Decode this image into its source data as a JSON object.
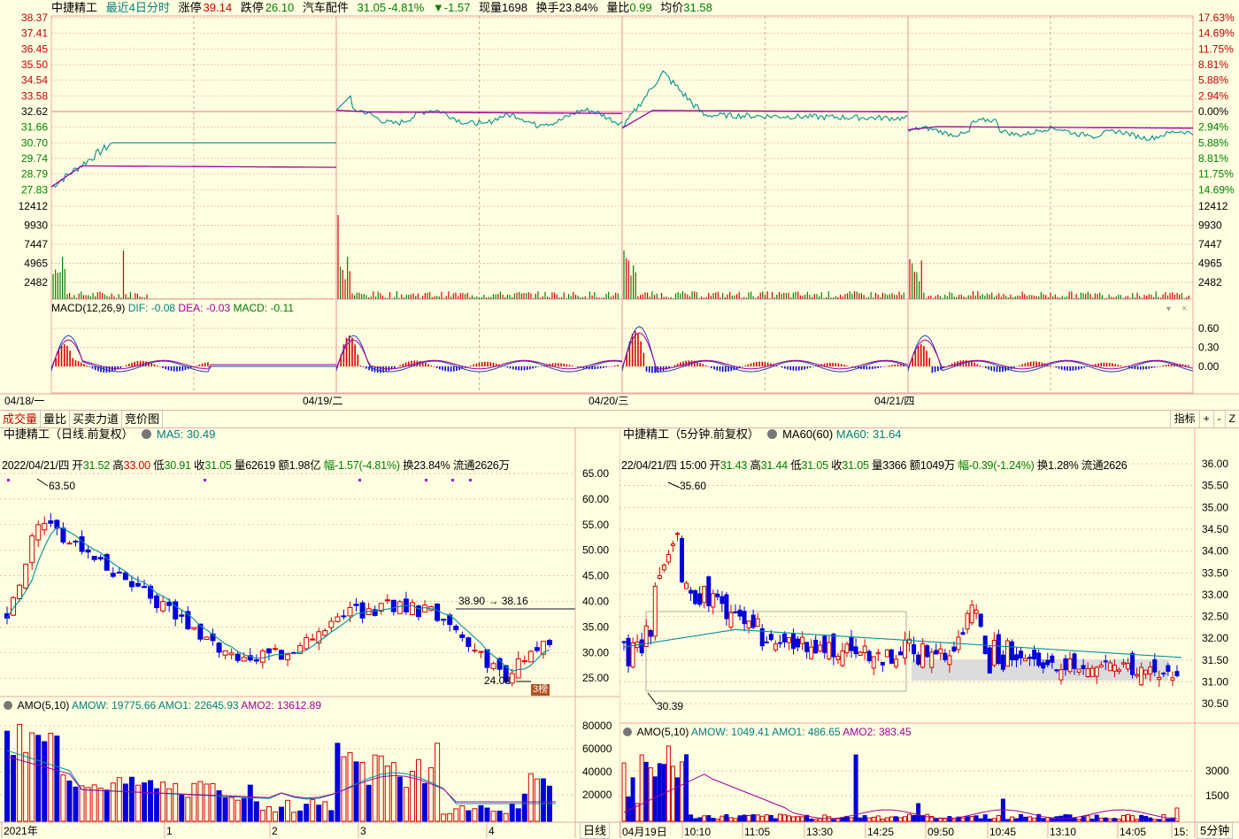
{
  "top": {
    "stock_name": "中捷精工",
    "period_label": "最近4日分时",
    "limit_up_label": "涨停",
    "limit_up_value": "39.14",
    "limit_down_label": "跌停",
    "limit_down_value": "26.10",
    "sector": "汽车配件",
    "price": "31.05",
    "change_pct": "-4.81%",
    "change_arrow": "▼",
    "change_val": "-1.57",
    "volume_label": "现量",
    "volume_value": "1698",
    "turnover_label": "换手",
    "turnover_value": "23.84%",
    "vol_ratio_label": "量比",
    "vol_ratio_value": "0.99",
    "avg_label": "均价",
    "avg_value": "31.58",
    "price_axis_left": [
      "38.37",
      "37.41",
      "36.45",
      "35.50",
      "34.54",
      "33.58",
      "32.62",
      "31.66",
      "30.70",
      "29.74",
      "28.79",
      "27.83"
    ],
    "pct_axis_right": [
      "17.63%",
      "14.69%",
      "11.75%",
      "8.81%",
      "5.88%",
      "2.94%",
      "0.00%",
      "2.94%",
      "5.88%",
      "8.81%",
      "11.75%",
      "14.69%"
    ],
    "vol_axis": [
      "12412",
      "9930",
      "7447",
      "4965",
      "2482"
    ],
    "macd_label": "MACD(12,26,9)",
    "macd_dif": "DIF: -0.08",
    "macd_dea": "DEA: -0.03",
    "macd_val": "MACD: -0.11",
    "macd_axis": [
      "0.60",
      "0.30",
      "0.00"
    ],
    "dates": [
      "04/18/一",
      "04/19/二",
      "04/20/三",
      "04/21/四"
    ]
  },
  "tabs": {
    "items": [
      "成交量",
      "量比",
      "买卖力道",
      "竞价图"
    ],
    "indicator": "指标",
    "plus": "+",
    "minus": "-",
    "z": "Z"
  },
  "daily": {
    "title": "中捷精工（日线.前复权）",
    "ma_label": "MA5: 30.49",
    "info_date": "2022/04/21/四",
    "info_open_label": "开",
    "info_open": "31.52",
    "info_high_label": "高",
    "info_high": "33.00",
    "info_low_label": "低",
    "info_low": "30.91",
    "info_close_label": "收",
    "info_close": "31.05",
    "info_vol": "量62619",
    "info_amt": "额1.98亿",
    "info_range": "幅-1.57(-4.81%)",
    "info_turn": "换23.84%",
    "info_float": "流通2626万",
    "high_mark": "63.50",
    "low_mark": "24.08",
    "range_mark": "38.90 → 38.16",
    "badge": "3榜",
    "price_axis": [
      "65.00",
      "60.00",
      "55.00",
      "50.00",
      "45.00",
      "40.00",
      "35.00",
      "30.00",
      "25.00"
    ],
    "amo_label": "AMO(5,10)",
    "amow": "AMOW: 19775.66",
    "amo1": "AMO1: 22645.93",
    "amo2": "AMO2: 13612.89",
    "amo_axis": [
      "80000",
      "60000",
      "40000",
      "20000"
    ],
    "x_labels": [
      "2021年",
      "1",
      "2",
      "3",
      "4"
    ],
    "period_tab": "日线"
  },
  "min5": {
    "title": "中捷精工（5分钟.前复权）",
    "ma60_label": "MA60(60)",
    "ma60_value": "MA60: 31.64",
    "info_date": "22/04/21/四",
    "info_time": "15:00",
    "info_open_label": "开",
    "info_open": "31.43",
    "info_high_label": "高",
    "info_high": "31.44",
    "info_low_label": "低",
    "info_low": "31.05",
    "info_close_label": "收",
    "info_close": "31.05",
    "info_vol": "量3366",
    "info_amt": "额1049万",
    "info_range": "幅-0.39(-1.24%)",
    "info_turn": "换1.28%",
    "info_float": "流通2626",
    "high_mark": "35.60",
    "low_mark": "30.39",
    "price_axis": [
      "36.00",
      "35.50",
      "35.00",
      "34.50",
      "34.00",
      "33.50",
      "33.00",
      "32.50",
      "32.00",
      "31.50",
      "31.00",
      "30.50"
    ],
    "amo_label": "AMO(5,10)",
    "amow": "AMOW: 1049.41",
    "amo1": "AMO1: 486.65",
    "amo2": "AMO2: 383.45",
    "amo_axis": [
      "3000",
      "1500"
    ],
    "x_labels": [
      "04月19日",
      "10:10",
      "11:05",
      "13:30",
      "14:25",
      "09:50",
      "10:45",
      "13:10",
      "14:05",
      "15:"
    ],
    "period_tab": "5分钟"
  },
  "colors": {
    "up": "#d40000",
    "down": "#0000d8",
    "price_line": "#009090",
    "avg_line": "#a000a0",
    "grid": "#e8a8a8",
    "axis_red": "#c00000",
    "axis_green": "#008000"
  }
}
